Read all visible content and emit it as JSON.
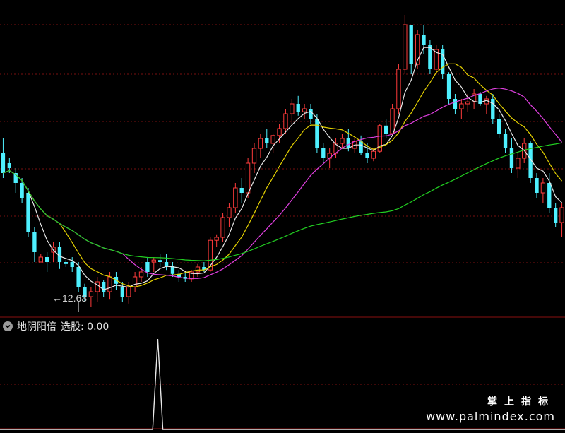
{
  "colors": {
    "background": "#000000",
    "up": "#ff3b3b",
    "down": "#4ef0ff",
    "ma_white": "#e8e8e8",
    "ma_yellow": "#e6d200",
    "ma_magenta": "#e040e0",
    "ma_green": "#22d022",
    "grid": "#7a1010",
    "signal": "#e8e8e8"
  },
  "chart_data": [
    {
      "type": "candlestick",
      "price_axis_visible": false,
      "annotations": [
        {
          "text": "12.63",
          "marker": "arrow-left"
        }
      ],
      "candles_approx": [
        [
          13.8,
          13.95,
          13.55,
          13.6
        ],
        [
          13.7,
          13.75,
          13.6,
          13.65
        ],
        [
          13.6,
          13.65,
          13.4,
          13.5
        ],
        [
          13.5,
          13.55,
          13.3,
          13.35
        ],
        [
          13.4,
          13.45,
          12.95,
          13.0
        ],
        [
          13.0,
          13.05,
          12.7,
          12.8
        ],
        [
          12.7,
          12.78,
          12.72,
          12.75
        ],
        [
          12.75,
          12.8,
          12.6,
          12.7
        ],
        [
          12.8,
          12.9,
          12.7,
          12.85
        ],
        [
          12.85,
          12.9,
          12.63,
          12.7
        ],
        [
          12.7,
          12.72,
          12.65,
          12.68
        ],
        [
          12.7,
          12.75,
          12.6,
          12.65
        ],
        [
          12.65,
          12.7,
          12.4,
          12.45
        ],
        [
          12.45,
          12.48,
          12.3,
          12.35
        ],
        [
          12.35,
          12.45,
          12.25,
          12.4
        ],
        [
          12.4,
          12.55,
          12.3,
          12.5
        ],
        [
          12.5,
          12.52,
          12.35,
          12.4
        ],
        [
          12.4,
          12.6,
          12.32,
          12.55
        ],
        [
          12.55,
          12.6,
          12.42,
          12.48
        ],
        [
          12.45,
          12.5,
          12.3,
          12.35
        ],
        [
          12.35,
          12.5,
          12.28,
          12.45
        ],
        [
          12.45,
          12.6,
          12.4,
          12.55
        ],
        [
          12.55,
          12.65,
          12.5,
          12.6
        ],
        [
          12.7,
          12.75,
          12.55,
          12.6
        ],
        [
          12.7,
          12.75,
          12.6,
          12.72
        ],
        [
          12.72,
          12.78,
          12.65,
          12.7
        ],
        [
          12.7,
          12.78,
          12.62,
          12.66
        ],
        [
          12.66,
          12.7,
          12.55,
          12.58
        ],
        [
          12.58,
          12.62,
          12.5,
          12.55
        ],
        [
          12.55,
          12.6,
          12.5,
          12.53
        ],
        [
          12.53,
          12.62,
          12.5,
          12.6
        ],
        [
          12.6,
          12.68,
          12.55,
          12.65
        ],
        [
          12.65,
          12.7,
          12.6,
          12.62
        ],
        [
          12.62,
          12.95,
          12.6,
          12.92
        ],
        [
          12.92,
          12.98,
          12.85,
          12.95
        ],
        [
          12.95,
          13.2,
          12.9,
          13.15
        ],
        [
          13.15,
          13.3,
          13.05,
          13.25
        ],
        [
          13.25,
          13.5,
          13.2,
          13.45
        ],
        [
          13.45,
          13.55,
          13.3,
          13.4
        ],
        [
          13.4,
          13.75,
          13.35,
          13.7
        ],
        [
          13.7,
          13.9,
          13.6,
          13.85
        ],
        [
          13.85,
          14.0,
          13.75,
          13.95
        ],
        [
          13.95,
          14.05,
          13.85,
          13.9
        ],
        [
          13.9,
          14.0,
          13.8,
          13.98
        ],
        [
          13.98,
          14.1,
          13.9,
          14.05
        ],
        [
          14.05,
          14.25,
          14.0,
          14.2
        ],
        [
          14.2,
          14.35,
          14.1,
          14.3
        ],
        [
          14.3,
          14.38,
          14.18,
          14.22
        ],
        [
          14.22,
          14.3,
          14.15,
          14.25
        ],
        [
          14.25,
          14.3,
          14.1,
          14.15
        ],
        [
          14.15,
          14.2,
          13.8,
          13.85
        ],
        [
          13.85,
          13.9,
          13.7,
          13.75
        ],
        [
          13.75,
          13.85,
          13.65,
          13.8
        ],
        [
          13.8,
          13.95,
          13.75,
          13.9
        ],
        [
          13.9,
          14.0,
          13.85,
          13.95
        ],
        [
          13.95,
          14.05,
          13.82,
          13.85
        ],
        [
          13.85,
          13.95,
          13.8,
          13.92
        ],
        [
          13.92,
          13.98,
          13.78,
          13.8
        ],
        [
          13.8,
          13.9,
          13.7,
          13.75
        ],
        [
          13.75,
          13.85,
          13.72,
          13.82
        ],
        [
          13.82,
          14.1,
          13.8,
          14.08
        ],
        [
          14.08,
          14.15,
          13.95,
          14.0
        ],
        [
          14.0,
          14.3,
          13.98,
          14.25
        ],
        [
          14.25,
          14.7,
          14.2,
          14.65
        ],
        [
          14.65,
          15.2,
          14.6,
          15.1
        ],
        [
          15.1,
          15.1,
          14.6,
          14.7
        ],
        [
          14.7,
          15.05,
          14.65,
          15.0
        ],
        [
          15.0,
          15.1,
          14.8,
          14.9
        ],
        [
          14.9,
          14.95,
          14.6,
          14.65
        ],
        [
          14.65,
          14.9,
          14.6,
          14.85
        ],
        [
          14.85,
          14.9,
          14.55,
          14.6
        ],
        [
          14.6,
          14.62,
          14.3,
          14.35
        ],
        [
          14.35,
          14.4,
          14.2,
          14.25
        ],
        [
          14.25,
          14.35,
          14.15,
          14.3
        ],
        [
          14.3,
          14.4,
          14.22,
          14.32
        ],
        [
          14.32,
          14.45,
          14.25,
          14.4
        ],
        [
          14.4,
          14.42,
          14.28,
          14.3
        ],
        [
          14.3,
          14.38,
          14.2,
          14.35
        ],
        [
          14.35,
          14.4,
          14.1,
          14.15
        ],
        [
          14.15,
          14.2,
          13.95,
          14.0
        ],
        [
          14.0,
          14.05,
          13.8,
          13.85
        ],
        [
          13.85,
          13.95,
          13.6,
          13.65
        ],
        [
          13.65,
          13.8,
          13.55,
          13.75
        ],
        [
          13.75,
          13.95,
          13.7,
          13.9
        ],
        [
          13.9,
          13.92,
          13.5,
          13.55
        ],
        [
          13.55,
          13.6,
          13.35,
          13.4
        ],
        [
          13.4,
          13.55,
          13.3,
          13.5
        ],
        [
          13.5,
          13.6,
          13.2,
          13.25
        ],
        [
          13.25,
          13.3,
          13.05,
          13.1
        ],
        [
          13.1,
          13.3,
          12.95,
          13.25
        ]
      ],
      "moving_averages": [
        {
          "color_key": "ma_white"
        },
        {
          "color_key": "ma_yellow"
        },
        {
          "color_key": "ma_magenta"
        },
        {
          "color_key": "ma_green"
        }
      ]
    },
    {
      "type": "line",
      "title": "地阴阳倍",
      "value_label": "选股",
      "value": "0.00",
      "signal_values": [
        0,
        0,
        0,
        0,
        0,
        0,
        0,
        0,
        0,
        0,
        0,
        0,
        0,
        0,
        0,
        0,
        0,
        0,
        0,
        0,
        0,
        0,
        0,
        0,
        0,
        0,
        0,
        0,
        0,
        0,
        0,
        1,
        0,
        0,
        0,
        0,
        0,
        0,
        0,
        0,
        0,
        0,
        0,
        0,
        0,
        0,
        0,
        0,
        0,
        0,
        0,
        0,
        0,
        0,
        0,
        0,
        0,
        0,
        0,
        0,
        0,
        0,
        0,
        0,
        0,
        0,
        0,
        0,
        0,
        0,
        0,
        0,
        0,
        0,
        0,
        0,
        0,
        0,
        0,
        0,
        0,
        0,
        0,
        0,
        0,
        0,
        0,
        0,
        0,
        0,
        0,
        0,
        0,
        0,
        0,
        0,
        0,
        0,
        0,
        0,
        0,
        0,
        0,
        0,
        0,
        0,
        0,
        0,
        0,
        0,
        0,
        0
      ]
    }
  ],
  "indicator": {
    "name": "地阴阳倍",
    "select_label": "选股",
    "value": "0.00"
  },
  "watermark": {
    "cn": "掌上指标",
    "url": "www.palmindex.com"
  }
}
